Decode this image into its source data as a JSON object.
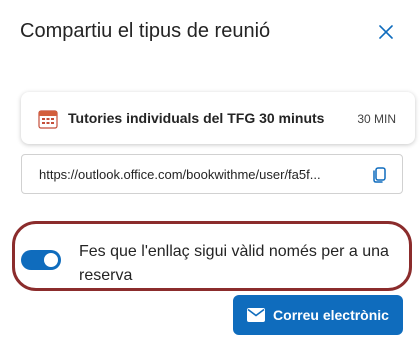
{
  "dialog": {
    "title": "Compartiu el tipus de reunió",
    "close_icon": "close-icon"
  },
  "meeting": {
    "name": "Tutories individuals del TFG 30 minuts",
    "duration": "30 MIN",
    "icon": "calendar-icon"
  },
  "link": {
    "url": "https://outlook.office.com/bookwithme/user/fa5f...",
    "copy_icon": "copy-icon"
  },
  "single_use_toggle": {
    "label": "Fes que l'enllaç sigui vàlid només per a una reserva",
    "checked": true
  },
  "actions": {
    "email_label": "Correu electrònic",
    "email_icon": "mail-icon"
  },
  "colors": {
    "accent": "#0f6cbd",
    "highlight_border": "#8b2c2c"
  }
}
